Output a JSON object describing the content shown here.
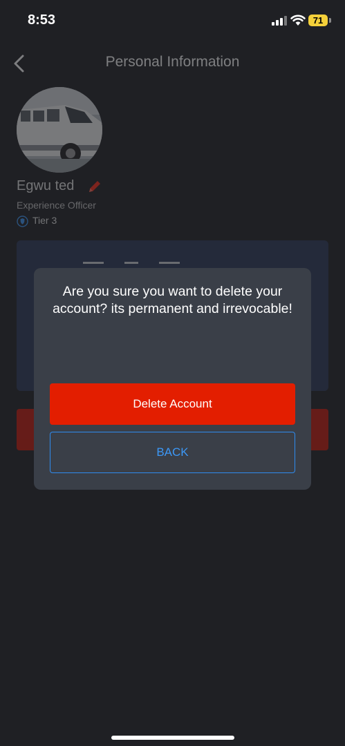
{
  "status_bar": {
    "time": "8:53",
    "battery_level": "71"
  },
  "header": {
    "title": "Personal Information",
    "back_icon": "chevron-left-icon"
  },
  "profile": {
    "avatar_icon": "van-photo",
    "name": "Egwu ted",
    "edit_icon": "pencil-icon",
    "role": "Experience Officer",
    "tier_icon": "shield-icon",
    "tier": "Tier 3"
  },
  "modal": {
    "message": "Are you sure you want to delete your account? its permanent and irrevocable!",
    "delete_label": "Delete Account",
    "back_label": "BACK"
  },
  "colors": {
    "background": "#1f2024",
    "modal": "#3a3f48",
    "danger": "#e31e00",
    "accent": "#2f8cf0"
  }
}
